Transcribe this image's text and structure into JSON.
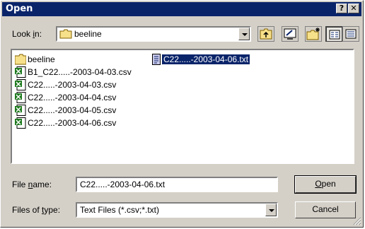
{
  "window": {
    "title": "Open",
    "help_glyph": "?",
    "close_glyph": "✕"
  },
  "lookin": {
    "label_pre": "Look ",
    "label_u": "i",
    "label_post": "n:",
    "value": "beeline"
  },
  "toolbar": {
    "icons": [
      "up-folder-icon",
      "desktop-icon",
      "new-folder-icon",
      "list-view-icon",
      "details-view-icon"
    ]
  },
  "files": [
    {
      "name": "beeline",
      "icon": "folder-icon"
    },
    {
      "name": "B1_C22.....-2003-04-03.csv",
      "icon": "excel-file-icon"
    },
    {
      "name": "C22.....-2003-04-03.csv",
      "icon": "excel-file-icon"
    },
    {
      "name": "C22.....-2003-04-04.csv",
      "icon": "excel-file-icon"
    },
    {
      "name": "C22.....-2003-04-05.csv",
      "icon": "excel-file-icon"
    },
    {
      "name": "C22.....-2003-04-06.csv",
      "icon": "excel-file-icon"
    },
    {
      "name": "C22.....-2003-04-06.txt",
      "icon": "text-file-icon",
      "selected": true
    }
  ],
  "filename": {
    "label_pre": "File ",
    "label_u": "n",
    "label_post": "ame:",
    "value": "C22.....-2003-04-06.txt"
  },
  "filetype": {
    "label_pre": "Files of ",
    "label_u": "t",
    "label_post": "ype:",
    "value": "Text Files (*.csv;*.txt)"
  },
  "buttons": {
    "open_u": "O",
    "open_rest": "pen",
    "cancel": "Cancel"
  },
  "colors": {
    "titlebar": "#0a246a",
    "face": "#d4d0c8",
    "selection": "#0a246a",
    "excel_green": "#1e7a1e",
    "folder_yellow": "#f7e08a"
  }
}
